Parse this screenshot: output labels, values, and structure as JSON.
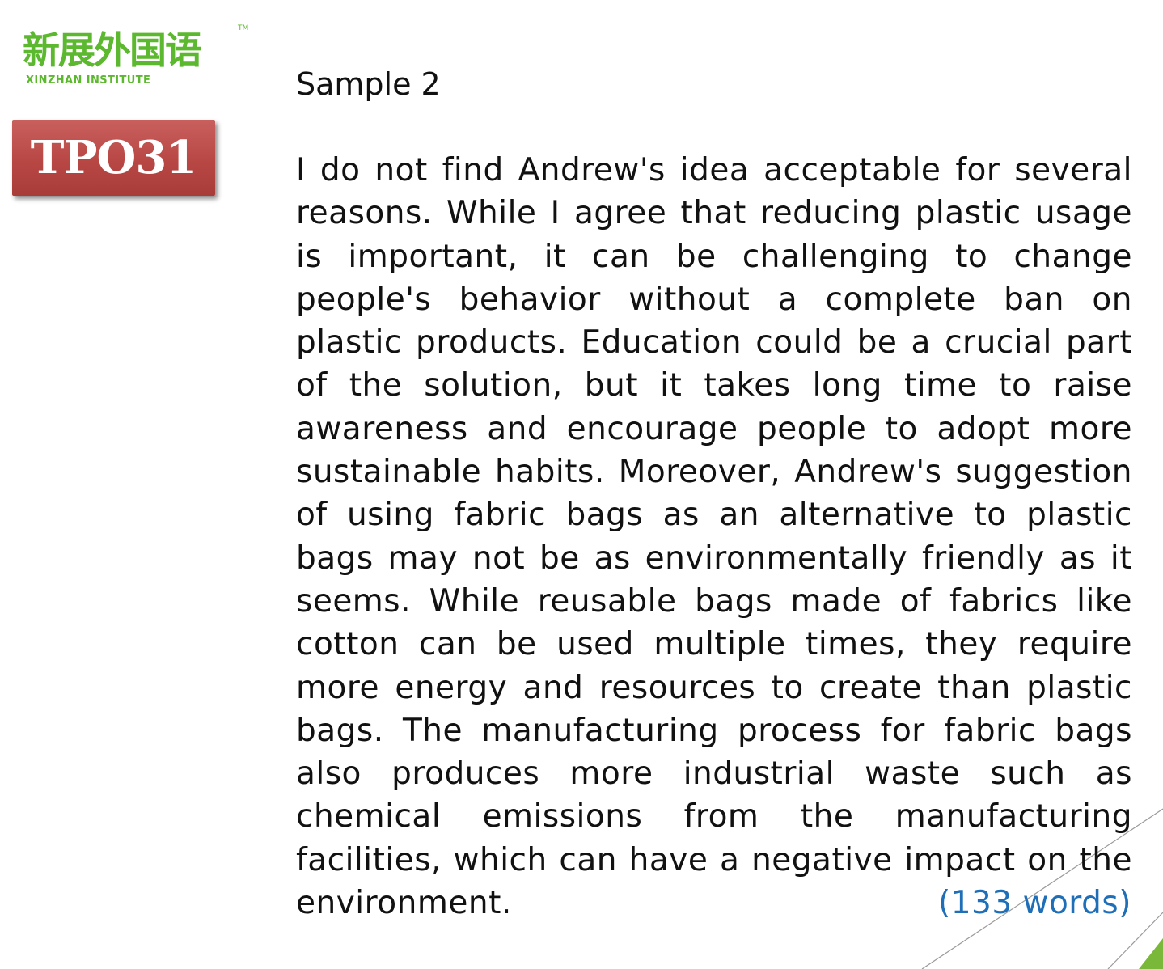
{
  "logo": {
    "chinese_text": "新展外国语",
    "english_text": "XINZHAN INSTITUTE",
    "trademark": "TM"
  },
  "badge": {
    "label": "TPO31"
  },
  "sample": {
    "title": "Sample 2",
    "lines": [
      "I do not find Andrew's idea acceptable for several",
      "reasons. While I agree that reducing plastic usage",
      "is important, it can be challenging to change",
      "people's behavior without a complete ban on",
      "plastic products. Education could be a crucial part",
      "of the solution, but it takes long time to raise",
      "awareness and encourage people to adopt more",
      "sustainable habits. Moreover, Andrew's suggestion",
      "of using fabric bags as an alternative to plastic",
      "bags may not be as environmentally friendly as it",
      "seems. While reusable bags made of fabrics like",
      "cotton can be used multiple times, they require",
      "more energy and resources to create than plastic",
      "bags. The manufacturing process for fabric bags",
      "also produces more industrial waste such as",
      "chemical emissions from the manufacturing",
      "facilities, which can have a negative impact on the",
      "environment."
    ],
    "word_count": "(133 words)"
  },
  "colors": {
    "logo_green": "#5cb82e",
    "badge_red": "#b84744",
    "word_count_blue": "#1e6fb8",
    "accent_green": "#7ab83a"
  }
}
